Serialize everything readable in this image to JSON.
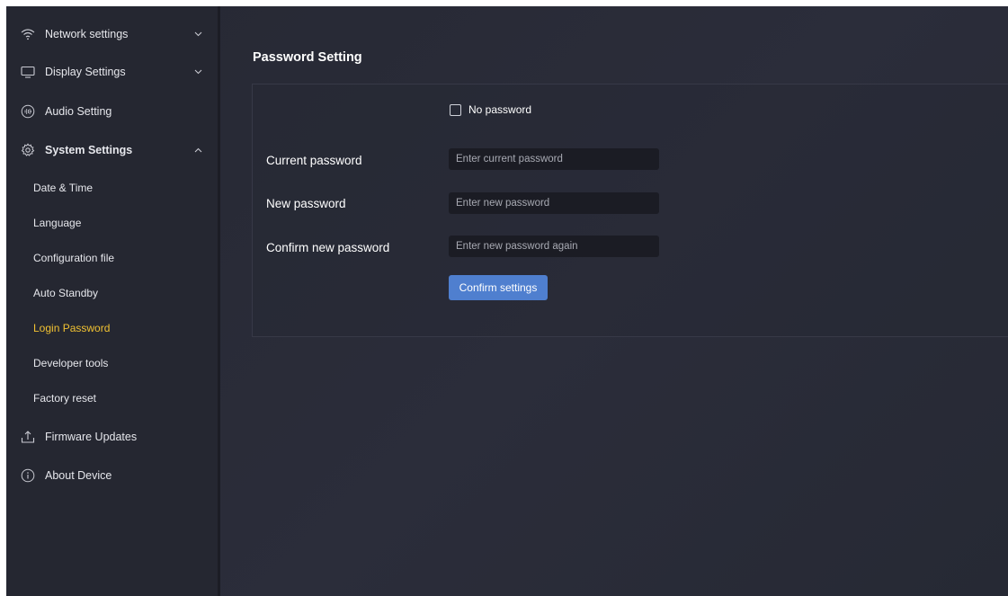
{
  "sidebar": {
    "items": [
      {
        "label": "Network settings",
        "icon": "wifi-icon",
        "chevron": "down"
      },
      {
        "label": "Display Settings",
        "icon": "monitor-icon",
        "chevron": "down"
      },
      {
        "label": "Audio Setting",
        "icon": "audio-icon"
      },
      {
        "label": "System Settings",
        "icon": "gear-icon",
        "chevron": "up"
      },
      {
        "label": "Firmware Updates",
        "icon": "upload-icon"
      },
      {
        "label": "About Device",
        "icon": "info-icon"
      }
    ],
    "subitems": [
      {
        "label": "Date & Time"
      },
      {
        "label": "Language"
      },
      {
        "label": "Configuration file"
      },
      {
        "label": "Auto Standby"
      },
      {
        "label": "Login Password",
        "active": true
      },
      {
        "label": "Developer tools"
      },
      {
        "label": "Factory reset"
      }
    ]
  },
  "main": {
    "title": "Password Setting",
    "no_password_label": "No password",
    "no_password_checked": false,
    "fields": [
      {
        "label": "Current password",
        "placeholder": "Enter current password",
        "value": ""
      },
      {
        "label": "New password",
        "placeholder": "Enter new password",
        "value": ""
      },
      {
        "label": "Confirm new password",
        "placeholder": "Enter new password again",
        "value": ""
      }
    ],
    "confirm_label": "Confirm settings"
  },
  "colors": {
    "background": "#2a2c38",
    "sidebar": "#252731",
    "active": "#f1c232",
    "button": "#4f7fcf",
    "input": "#1b1c24"
  }
}
